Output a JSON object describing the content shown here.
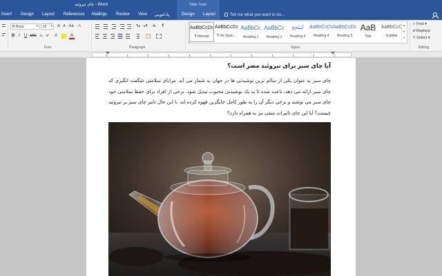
{
  "window": {
    "title": "چای تیروئید - Word"
  },
  "contextual_tab_group": {
    "label": "Table Tools"
  },
  "tabs": [
    "Insert",
    "Design",
    "Layout",
    "References",
    "Mailings",
    "Review",
    "View",
    "پادکتویبی",
    "Design",
    "Layout"
  ],
  "tell_me": {
    "placeholder": "Tell me what you want to do..."
  },
  "font": {
    "name": "B Roya",
    "size": "22"
  },
  "group_labels": {
    "font": "Font",
    "paragraph": "Paragraph",
    "styles": "Styles",
    "editing": "Editing"
  },
  "styles": [
    {
      "sample": "AaBbCcDc",
      "name": "¶ Normal"
    },
    {
      "sample": "AaBbCcDc",
      "name": "¶ No Spac..."
    },
    {
      "sample": "AaBbCc",
      "name": "Heading 1"
    },
    {
      "sample": "AaBbCc",
      "name": "Heading 2"
    },
    {
      "sample": "آبتثجح",
      "name": "Heading 3"
    },
    {
      "sample": "AaBbCcDc",
      "name": "Heading 4"
    },
    {
      "sample": "AaBbCcDc",
      "name": "Heading 5"
    },
    {
      "sample": "AaB",
      "name": "Title"
    },
    {
      "sample": "AaBbCcC",
      "name": "Subtitle"
    }
  ],
  "editing": {
    "find": "Find",
    "replace": "Replace",
    "select": "Select"
  },
  "document": {
    "heading": "آیا چای سبز برای تیروئید مضر است؟",
    "body": "چای سبز به عنوان یکی از سالم ترین نوشیدنی ها در جهان به شمار می آید. مزایای سلامتی شگفت انگیزی که چای سبز ارائه می دهد، باعث شده تا به یک نوشیدنی محبوب تبدیل شود. برخی از افراد برای حفظ سلامتی خود چای سبز می نوشند و برخی دیگر آن را به طور کامل جایگزین قهوه کرده اند. با این حال تاثیر چای سبز بر تیروئید چیست؟ آیا این چای تاثیرات منفی نیز به همراه دارد؟"
  },
  "colors": {
    "title_bar": "#2b579a",
    "contextual_band": "#3b69ad",
    "ribbon_bg": "#f3f3f3",
    "canvas_bg": "#c6c6c6",
    "heading_style_color": "#2e74b5"
  }
}
